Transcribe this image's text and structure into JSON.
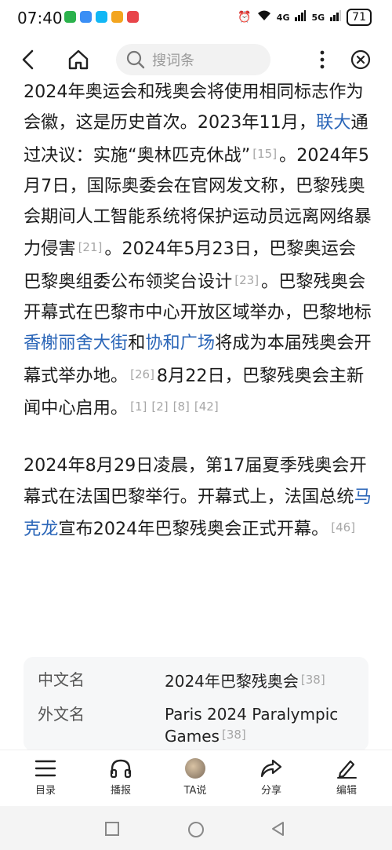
{
  "status_bar": {
    "time": "07:40",
    "network_4g": "4G",
    "network_5g": "5G",
    "battery": "71"
  },
  "nav": {
    "search_placeholder": "搜词条"
  },
  "article": {
    "p1_parts": [
      {
        "type": "text",
        "text": "2024年奥运会和残奥会将使用相同标志作为会徽，这是历史首次。2023年11月，"
      },
      {
        "type": "link",
        "text": "联大"
      },
      {
        "type": "text",
        "text": "通过决议：实施“奥林匹克休战”"
      },
      {
        "type": "ref",
        "text": "[15]"
      },
      {
        "type": "text",
        "text": "。2024年5月7日，国际奥委会在官网发文称，巴黎残奥会期间人工智能系统将保护运动员远离网络暴力侵害"
      },
      {
        "type": "ref",
        "text": "[21]"
      },
      {
        "type": "text",
        "text": "。2024年5月23日，巴黎奥运会巴黎奥组委公布领奖台设计"
      },
      {
        "type": "ref",
        "text": "[23]"
      },
      {
        "type": "text",
        "text": "。巴黎残奥会开幕式在巴黎市中心开放区域举办，巴黎地标"
      },
      {
        "type": "link",
        "text": "香榭丽舍大街"
      },
      {
        "type": "text",
        "text": "和"
      },
      {
        "type": "link",
        "text": "协和广场"
      },
      {
        "type": "text",
        "text": "将成为本届残奥会开幕式举办地。"
      },
      {
        "type": "ref",
        "text": "[26]"
      },
      {
        "type": "text",
        "text": "8月22日，巴黎残奥会主新闻中心启用。"
      },
      {
        "type": "ref",
        "text": "[1]"
      },
      {
        "type": "ref",
        "text": "[2]"
      },
      {
        "type": "ref",
        "text": "[8]"
      },
      {
        "type": "ref",
        "text": "[42]"
      }
    ],
    "p2_parts": [
      {
        "type": "text",
        "text": "2024年8月29日凌晨，第17届夏季残奥会开幕式在法国巴黎举行。开幕式上，法国总统"
      },
      {
        "type": "link",
        "text": "马克龙"
      },
      {
        "type": "text",
        "text": "宣布2024年巴黎残奥会正式开幕。"
      },
      {
        "type": "ref",
        "text": "[46]"
      }
    ]
  },
  "infobox": {
    "row1_key": "中文名",
    "row1_val": "2024年巴黎残奥会",
    "row1_ref": "[38]",
    "row2_key": "外文名",
    "row2_val": "Paris 2024 Paralympic Games",
    "row2_ref": "[38]"
  },
  "toolbar": {
    "contents": "目录",
    "broadcast": "播报",
    "ta": "TA说",
    "share": "分享",
    "edit": "编辑"
  },
  "colors": {
    "link": "#2b66b8",
    "ref": "#a7a7a7"
  }
}
